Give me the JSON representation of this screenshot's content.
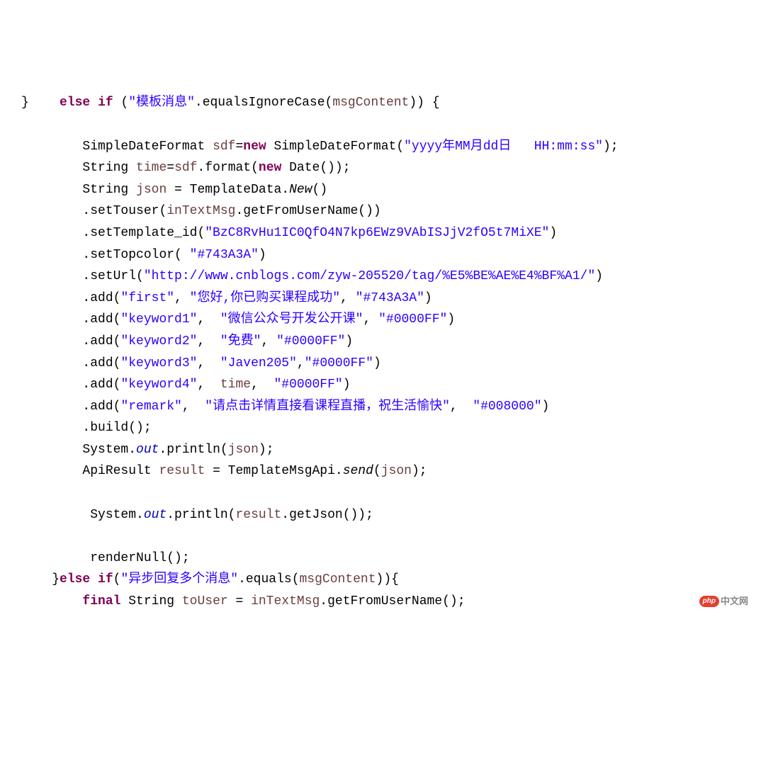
{
  "code_tokens": {
    "l1_brace": "}",
    "l1_else": "else",
    "l1_if": "if",
    "l1_paren_open": " (",
    "l1_str": "\"模板消息\"",
    "l1_method": ".equalsIgnoreCase(",
    "l1_param": "msgContent",
    "l1_close": ")) {",
    "l3_type1": "SimpleDateFormat ",
    "l3_var": "sdf",
    "l3_eq": "=",
    "l3_new": "new",
    "l3_type2": " SimpleDateFormat(",
    "l3_str": "\"yyyy年MM月dd日   HH:mm:ss\"",
    "l3_close": ");",
    "l4_type": "String ",
    "l4_var": "time",
    "l4_eq": "=",
    "l4_var2": "sdf",
    "l4_method": ".format(",
    "l4_new": "new",
    "l4_type2": " Date());",
    "l5_type": "String ",
    "l5_var": "json",
    "l5_eq": " = ",
    "l5_class": "TemplateData.",
    "l5_method": "New",
    "l5_close": "()",
    "l6_method": ".setTouser(",
    "l6_var": "inTextMsg",
    "l6_method2": ".getFromUserName())",
    "l7_method": ".setTemplate_id(",
    "l7_str": "\"BzC8RvHu1IC0QfO4N7kp6EWz9VAbISJjV2fO5t7MiXE\"",
    "l7_close": ")",
    "l8_method": ".setTopcolor( ",
    "l8_str": "\"#743A3A\"",
    "l8_close": ")",
    "l9_method": ".setUrl(",
    "l9_str": "\"http://www.cnblogs.com/zyw-205520/tag/%E5%BE%AE%E4%BF%A1/\"",
    "l9_close": ")",
    "l10_method": ".add(",
    "l10_str1": "\"first\"",
    "l10_comma": ", ",
    "l10_str2": "\"您好,你已购买课程成功\"",
    "l10_comma2": ", ",
    "l10_str3": "\"#743A3A\"",
    "l10_close": ")",
    "l11_method": ".add(",
    "l11_str1": "\"keyword1\"",
    "l11_comma": ",  ",
    "l11_str2": "\"微信公众号开发公开课\"",
    "l11_comma2": ", ",
    "l11_str3": "\"#0000FF\"",
    "l11_close": ")",
    "l12_method": ".add(",
    "l12_str1": "\"keyword2\"",
    "l12_comma": ",  ",
    "l12_str2": "\"免费\"",
    "l12_comma2": ", ",
    "l12_str3": "\"#0000FF\"",
    "l12_close": ")",
    "l13_method": ".add(",
    "l13_str1": "\"keyword3\"",
    "l13_comma": ",  ",
    "l13_str2": "\"Javen205\"",
    "l13_comma2": ",",
    "l13_str3": "\"#0000FF\"",
    "l13_close": ")",
    "l14_method": ".add(",
    "l14_str1": "\"keyword4\"",
    "l14_comma": ",  ",
    "l14_var": "time",
    "l14_comma2": ",  ",
    "l14_str3": "\"#0000FF\"",
    "l14_close": ")",
    "l15_method": ".add(",
    "l15_str1": "\"remark\"",
    "l15_comma": ",  ",
    "l15_str2": "\"请点击详情直接看课程直播，祝生活愉快\"",
    "l15_comma2": ",  ",
    "l15_str3": "\"#008000\"",
    "l15_close": ")",
    "l16_method": ".build();",
    "l17_class": "System.",
    "l17_out": "out",
    "l17_method": ".println(",
    "l17_var": "json",
    "l17_close": ");",
    "l18_type": "ApiResult ",
    "l18_var": "result",
    "l18_eq": " = ",
    "l18_class": "TemplateMsgApi.",
    "l18_method": "send",
    "l18_open": "(",
    "l18_var2": "json",
    "l18_close": ");",
    "l20_class": "System.",
    "l20_out": "out",
    "l20_method": ".println(",
    "l20_var": "result",
    "l20_method2": ".getJson());",
    "l22_method": "renderNull();",
    "l23_brace": "}",
    "l23_else": "else",
    "l23_if": " if",
    "l23_open": "(",
    "l23_str": "\"异步回复多个消息\"",
    "l23_method": ".equals(",
    "l23_param": "msgContent",
    "l23_close": ")){",
    "l24_final": "final",
    "l24_type": " String ",
    "l24_var": "toUser",
    "l24_eq": " = ",
    "l24_var2": "inTextMsg",
    "l24_method": ".getFromUserName();"
  },
  "logo": {
    "badge": "php",
    "text": "中文网"
  }
}
